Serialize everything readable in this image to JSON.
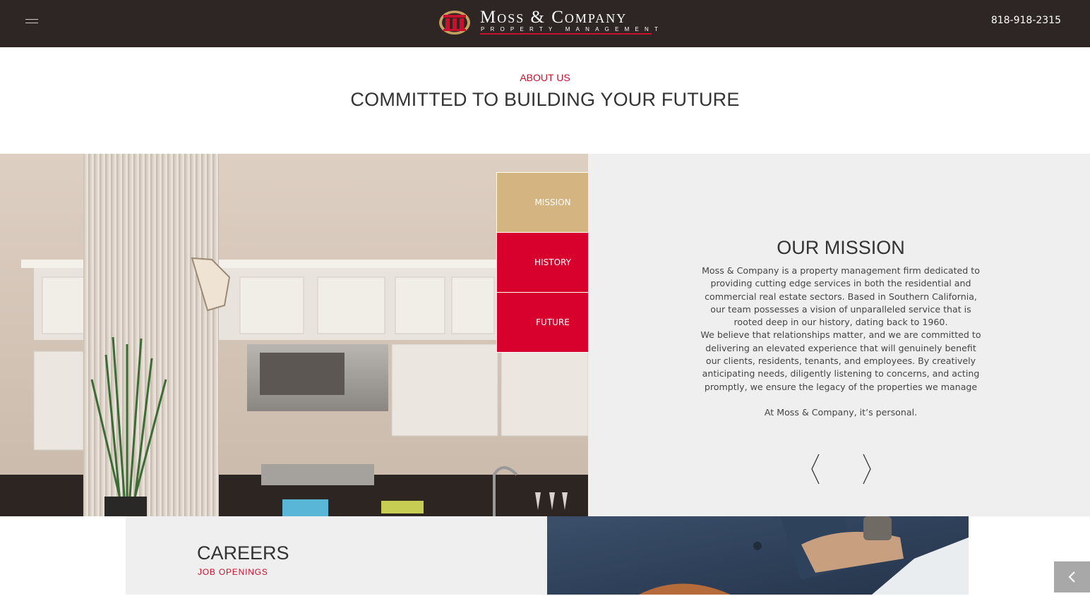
{
  "header": {
    "logo_name": "Moss & Company",
    "logo_tagline": "PROPERTY MANAGEMENT",
    "phone": "818-918-2315"
  },
  "intro": {
    "eyebrow": "ABOUT US",
    "headline": "COMMITTED TO BUILDING YOUR FUTURE"
  },
  "tabs": [
    {
      "label": "MISSION",
      "active": true
    },
    {
      "label": "HISTORY",
      "active": false
    },
    {
      "label": "FUTURE",
      "active": false
    }
  ],
  "mission": {
    "title": "OUR MISSION",
    "paragraph_1": "Moss & Company is a property management firm dedicated to providing cutting edge services in both the residential and commercial real estate sectors. Based in Southern California, our team possesses a vision of unparalleled service that is rooted deep in our history, dating back to 1960.",
    "paragraph_2": "We believe that relationships matter, and we are committed to delivering an elevated experience that will genuinely benefit our clients, residents, tenants, and employees. By creatively anticipating needs, diligently listening to concerns, and acting promptly, we ensure the legacy of the properties we manage",
    "closing": "At Moss & Company, it’s personal."
  },
  "careers": {
    "title": "CAREERS",
    "link": "JOB OPENINGS"
  },
  "colors": {
    "header_bg": "#2e2624",
    "accent_red": "#d8002c",
    "tab_gold": "#d4b481",
    "panel_bg": "#efefef"
  },
  "icons": {
    "menu": "hamburger-menu-icon",
    "prev": "chevron-left-icon",
    "next": "chevron-right-icon",
    "back": "chevron-left-icon"
  }
}
